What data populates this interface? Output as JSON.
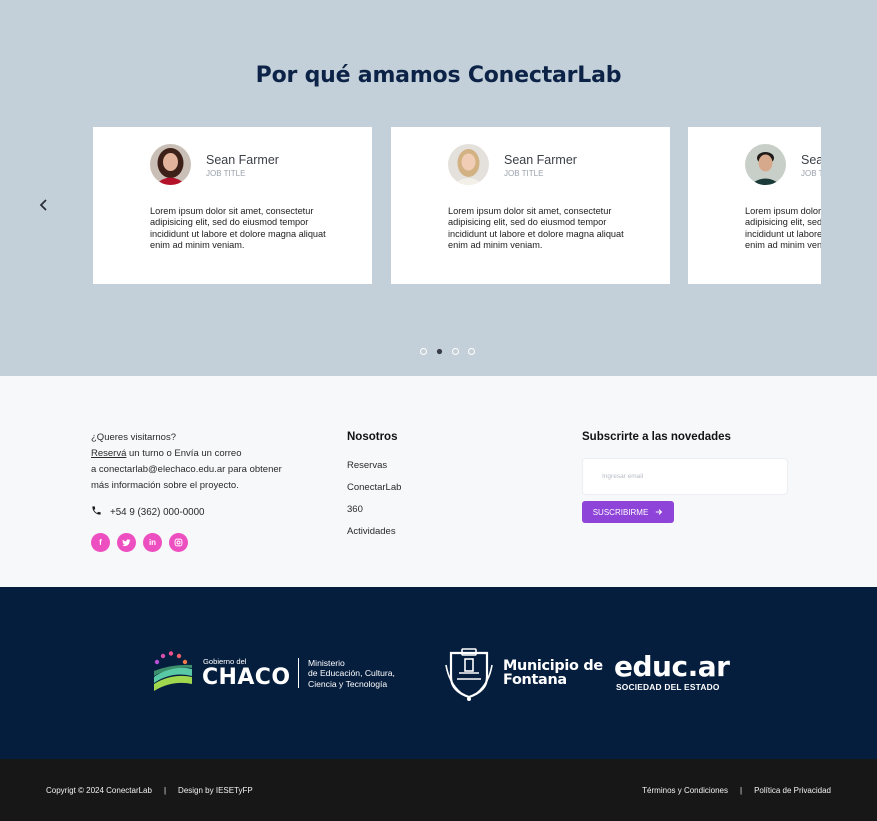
{
  "testimonials": {
    "title": "Por qué amamos ConectarLab",
    "cards": [
      {
        "name": "Sean Farmer",
        "role": "JOB TITLE",
        "text": "Lorem ipsum dolor sit amet, consectetur adipisicing elit, sed do eiusmod tempor incididunt ut labore et dolore magna aliquat enim ad minim veniam."
      },
      {
        "name": "Sean Farmer",
        "role": "JOB TITLE",
        "text": "Lorem ipsum dolor sit amet, consectetur adipisicing elit, sed do eiusmod tempor incididunt ut labore et dolore magna aliquat enim ad minim veniam."
      },
      {
        "name": "Sean Farmer",
        "role": "JOB TITLE",
        "text": "Lorem ipsum dolor sit amet, consectetur adipisicing elit, sed do eiusmod tempor incididunt ut labore et dolore magna aliquat enim ad minim veniam."
      }
    ],
    "dots_total": 4,
    "active_dot": 2,
    "prev_icon": "chevron-left-icon"
  },
  "contact": {
    "line1": "¿Queres visitarnos?",
    "link": "Reservá",
    "line2_rest": " un turno o Envía un correo",
    "line3": "a conectarlab@elechaco.edu.ar para obtener",
    "line4": "más información sobre el proyecto.",
    "phone": "+54 9 (362) 000-0000",
    "social": [
      {
        "icon": "facebook-icon",
        "glyph": "f"
      },
      {
        "icon": "twitter-icon",
        "glyph": "t"
      },
      {
        "icon": "linkedin-icon",
        "glyph": "in"
      },
      {
        "icon": "instagram-icon",
        "glyph": "◎"
      }
    ]
  },
  "nosotros": {
    "title": "Nosotros",
    "items": [
      "Reservas",
      "ConectarLab",
      "360",
      "Actividades"
    ]
  },
  "subscribe": {
    "title": "Subscrirte a las novedades",
    "placeholder": "Ingresar email",
    "button": "SUSCRIBIRME"
  },
  "sponsors": {
    "chaco_gob": "Gobierno del",
    "chaco_name": "CHACO",
    "chaco_ministry": "Ministerio\nde Educación, Cultura,\nCiencia y Tecnología",
    "fontana": "Municipio de\nFontana",
    "educ": "educ.ar",
    "educ_sub": "SOCIEDAD DEL ESTADO"
  },
  "bottom": {
    "copyright": "Copyrigt © 2024 ConectarLab",
    "separator": "|",
    "design": "Design by IESETyFP",
    "terms": "Términos y Condiciones",
    "privacy": "Política de Privacidad"
  },
  "colors": {
    "testimonial_bg": "#c3d0d9",
    "title": "#0c2347",
    "social": "#ee4fc0",
    "button": "#8e44d9",
    "sponsors_bg": "#061e3e",
    "bottom_bg": "#171717"
  }
}
